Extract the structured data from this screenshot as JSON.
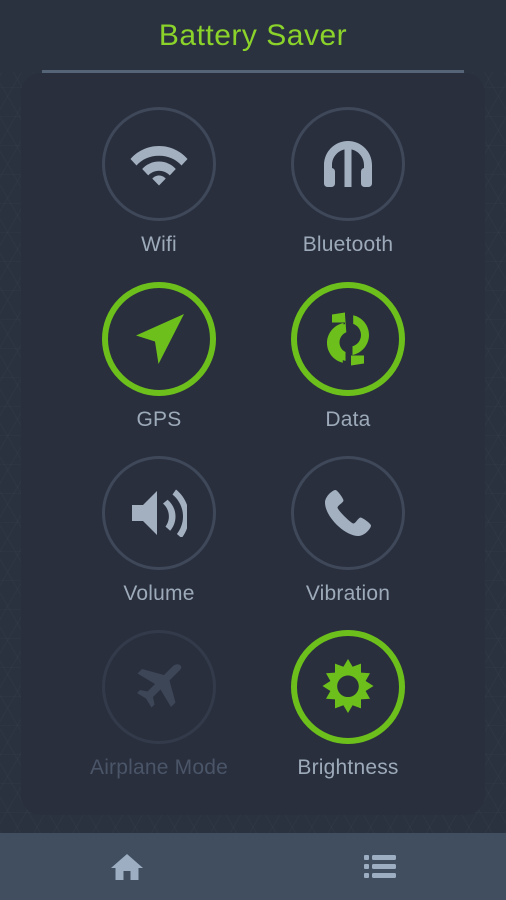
{
  "header": {
    "title": "Battery Saver",
    "title_color": "#8bd32a"
  },
  "theme": {
    "background": "#2a313f",
    "card": "#292f3d",
    "accent_green": "#6dc01c",
    "inactive_ring": "#3e4859",
    "inactive_glyph": "#a3b0c0",
    "label": "#9daab9",
    "disabled_label": "#4a5568",
    "nav_bar": "#404e60"
  },
  "toggles": [
    {
      "id": "wifi",
      "label": "Wifi",
      "icon": "wifi-icon",
      "state": "off"
    },
    {
      "id": "bluetooth",
      "label": "Bluetooth",
      "icon": "headphones-icon",
      "state": "off"
    },
    {
      "id": "gps",
      "label": "GPS",
      "icon": "navigation-icon",
      "state": "on"
    },
    {
      "id": "data",
      "label": "Data",
      "icon": "sync-icon",
      "state": "on"
    },
    {
      "id": "volume",
      "label": "Volume",
      "icon": "speaker-icon",
      "state": "off"
    },
    {
      "id": "vibration",
      "label": "Vibration",
      "icon": "phone-icon",
      "state": "off"
    },
    {
      "id": "airplane",
      "label": "Airplane Mode",
      "icon": "airplane-icon",
      "state": "disabled"
    },
    {
      "id": "brightness",
      "label": "Brightness",
      "icon": "sun-icon",
      "state": "on"
    }
  ],
  "bottom_nav": [
    {
      "id": "home",
      "icon": "home-icon"
    },
    {
      "id": "list",
      "icon": "list-icon"
    }
  ]
}
